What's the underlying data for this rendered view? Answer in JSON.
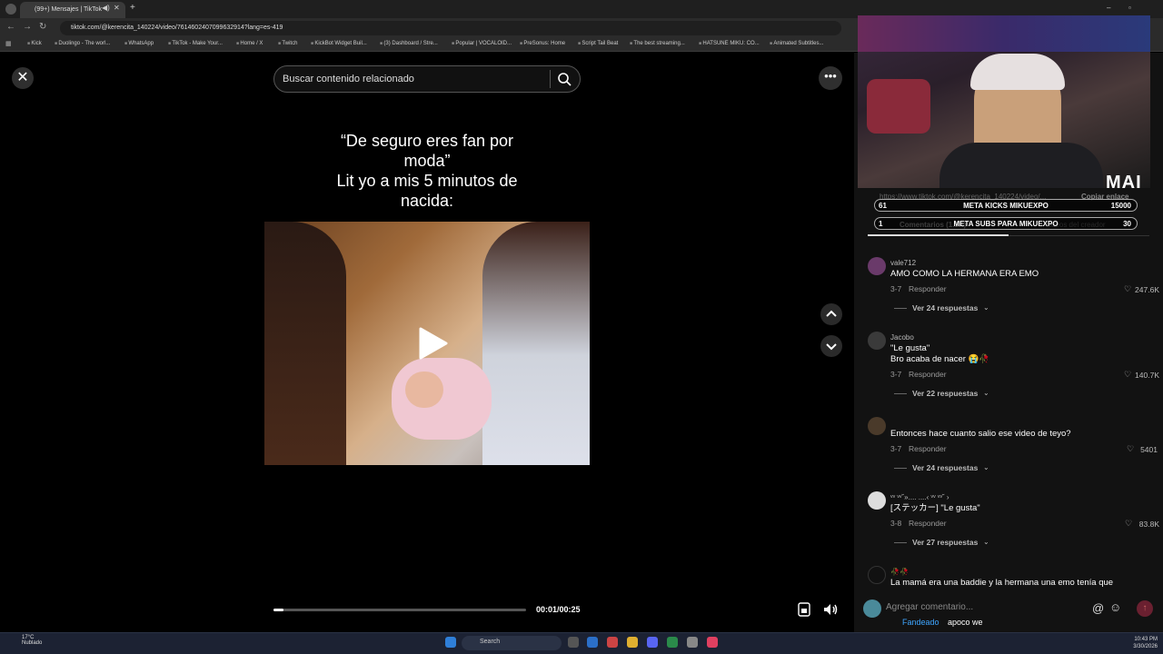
{
  "browser": {
    "tab_title": "(99+) Mensajes | TikTok",
    "url": "tiktok.com/@kerencita_140224/video/7614602407099632914?lang=es-419",
    "bookmarks": [
      "Kick",
      "Duolingo - The worl...",
      "WhatsApp",
      "TikTok - Make Your...",
      "Home / X",
      "Twitch",
      "KickBot Widget Buil...",
      "(3) Dashboard / Stre...",
      "Popular | VOCALOID...",
      "PreSonus: Home",
      "Script Tail Beat",
      "The best streaming...",
      "HATSUNE MIKU: CO...",
      "Animated Subtitles..."
    ]
  },
  "video_viewer": {
    "search_placeholder": "Buscar contenido relacionado",
    "caption_lines": [
      "“De seguro eres fan por",
      "moda”",
      "Lit yo a mis 5 minutos de",
      "nacida:"
    ],
    "progress_fraction": 0.04,
    "timecode": "00:01/00:25"
  },
  "overlay": {
    "streamer_tag": "MAI",
    "goals": [
      {
        "left": "61",
        "label": "META KICKS MIKUEXPO",
        "right": "15000"
      },
      {
        "left": "1",
        "label": "META SUBS PARA MIKUEXPO",
        "right": "30"
      }
    ]
  },
  "panel": {
    "share_url": "https://www.tiktok.com/@kerencita_140224/video/...",
    "copy_link": "Copiar enlace",
    "tab_comments": "Comentarios (1.5K)",
    "tab_creator": "Videos del creador",
    "comments": [
      {
        "user": "vale712",
        "text": "AMO COMO LA HERMANA ERA EMO",
        "date": "3-7",
        "reply": "Responder",
        "likes": "247.6K",
        "replies": "Ver 24 respuestas"
      },
      {
        "user": "Jacobo",
        "text": "\"Le gusta\"",
        "text2": "Bro acaba de nacer 😭🥀",
        "date": "3-7",
        "reply": "Responder",
        "likes": "140.7K",
        "replies": "Ver 22 respuestas"
      },
      {
        "user": "",
        "text": "Entonces hace cuanto salio ese video de teyo?",
        "date": "3-7",
        "reply": "Responder",
        "likes": "5401",
        "replies": "Ver 24 respuestas"
      },
      {
        "user": "ᵛᵛ ᵛᵛ˘».... ....‹ ᵛᵛ ᵛᵛ˘ ›",
        "text": "[ステッカー] \"Le gusta\"",
        "date": "3-8",
        "reply": "Responder",
        "likes": "83.8K",
        "replies": "Ver 27 respuestas"
      },
      {
        "user": "🥀🥀",
        "text": "La mamá era una baddie y la hermana una emo tenía que"
      }
    ],
    "composer_placeholder": "Agregar comentario...",
    "chat_name": "Fandeado",
    "chat_message": "apoco we"
  },
  "taskbar": {
    "weather_temp": "17°C",
    "weather_desc": "Nublado",
    "search_label": "Search",
    "time": "10:43 PM",
    "date": "3/30/2026"
  }
}
